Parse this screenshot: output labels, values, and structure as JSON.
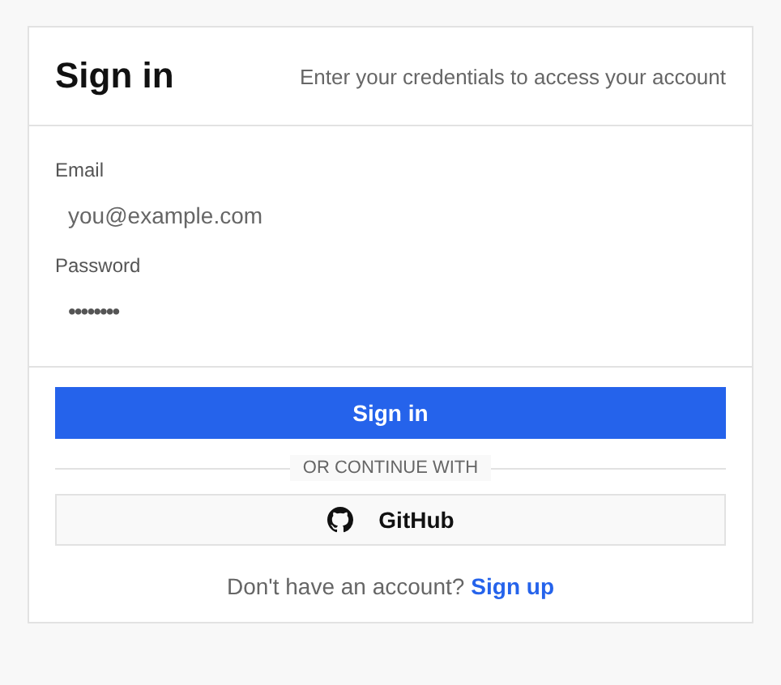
{
  "header": {
    "title": "Sign in",
    "subtitle": "Enter your credentials to access your account"
  },
  "fields": [
    {
      "label": "Email",
      "placeholder": "you@example.com",
      "kind": "email"
    },
    {
      "label": "Password",
      "value": "••••••••",
      "kind": "password"
    }
  ],
  "submit": {
    "label": "Sign in"
  },
  "divider": {
    "label": "OR CONTINUE WITH"
  },
  "providers": [
    {
      "label": "GitHub",
      "kind": "github"
    }
  ],
  "footer": {
    "text": "Don't have an account?",
    "link": "Sign up"
  }
}
